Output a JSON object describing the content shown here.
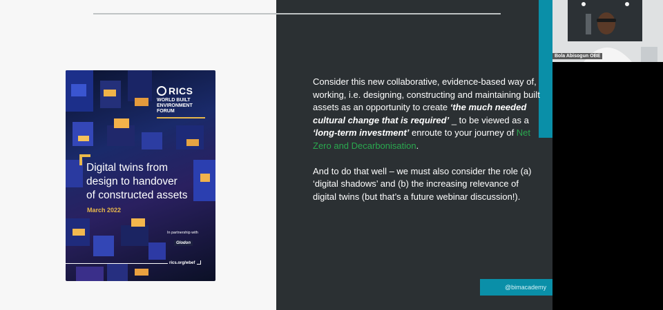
{
  "slide": {
    "cover": {
      "brand": "RICS",
      "forum": "WORLD BUILT ENVIRONMENT FORUM",
      "title_lines": [
        "Digital twins from",
        "design to handover",
        "of constructed assets"
      ],
      "date": "March 2022",
      "partner_label": "In partnership with",
      "partner_name": "Glodon",
      "url": "rics.org/wbef"
    },
    "body": {
      "p1_a": "Consider this new collaborative, evidence-based way of, working, i.e. designing, constructing and maintaining built assets as an opportunity to create ",
      "p1_b": "‘the much needed cultural change that is required’",
      "p1_c": " _ to be viewed as a ",
      "p1_d": "‘long-term investment’",
      "p1_e": " enroute to your journey of ",
      "p1_f": "Net Zero and Decarbonisation",
      "p1_g": ".",
      "p2": "And to do that well – we must also consider the role (a) ‘digital shadows’ and (b) the increasing relevance of digital twins (but that’s a future webinar discussion!)."
    },
    "handle": "@bimacademy"
  },
  "participant": {
    "name": "Bola Abisogun OBE"
  },
  "colors": {
    "teal": "#0a8fa8",
    "panel_dark": "#2b3033",
    "green_link": "#2aa84f",
    "gold": "#e8b84b"
  }
}
